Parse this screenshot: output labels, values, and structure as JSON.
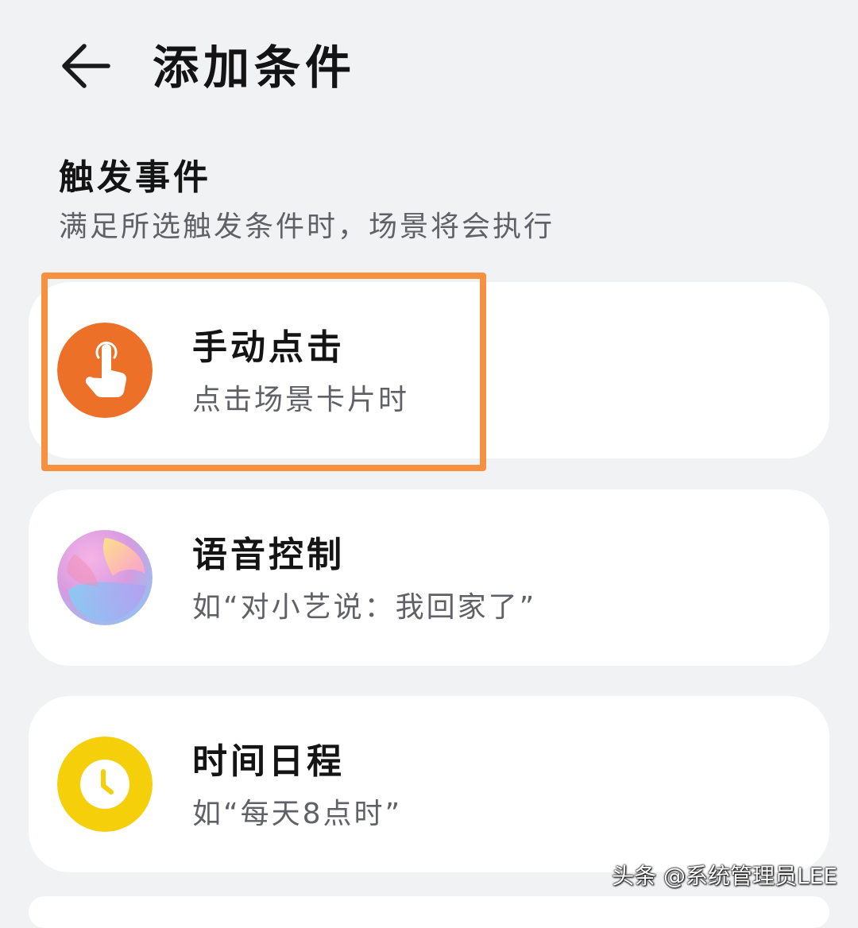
{
  "header": {
    "title": "添加条件",
    "back_icon": "arrow-left-icon"
  },
  "section": {
    "title": "触发事件",
    "subtitle": "满足所选触发条件时，场景将会执行"
  },
  "cards": [
    {
      "title": "手动点击",
      "subtitle": "点击场景卡片时",
      "icon": "tap-hand-icon",
      "icon_color": "#ec7027",
      "highlighted": true
    },
    {
      "title": "语音控制",
      "subtitle": "如“对小艺说：我回家了”",
      "icon": "voice-assistant-orb-icon",
      "icon_color": "#e9a6dc"
    },
    {
      "title": "时间日程",
      "subtitle": "如“每天8点时”",
      "icon": "clock-icon",
      "icon_color": "#f4cf0a"
    }
  ],
  "colors": {
    "background": "#f1f2f4",
    "card": "#ffffff",
    "highlight_border": "#f7913f",
    "secondary_text": "#5f6166"
  },
  "watermark": "头条 @系统管理员LEE"
}
